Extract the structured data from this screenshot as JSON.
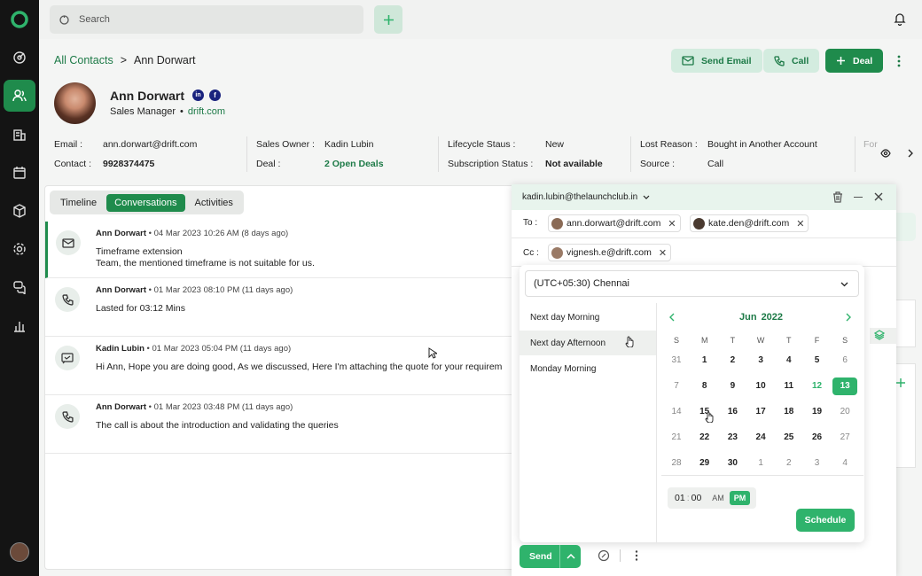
{
  "topbar": {
    "search_placeholder": "Search"
  },
  "breadcrumb": {
    "parent": "All Contacts",
    "sep": ">",
    "current": "Ann Dorwart"
  },
  "actions": {
    "send_email": "Send Email",
    "call": "Call",
    "deal": "Deal"
  },
  "contact": {
    "name": "Ann Dorwart",
    "title": "Sales Manager",
    "bullet": "•",
    "company": "drift.com",
    "linkedin": "in",
    "facebook": "f"
  },
  "fields": {
    "email_label": "Email :",
    "email": "ann.dorwart@drift.com",
    "contact_label": "Contact :",
    "contact": "9928374475",
    "owner_label": "Sales Owner :",
    "owner": "Kadin Lubin",
    "deal_label": "Deal :",
    "deal": "2 Open Deals",
    "lifecycle_label": "Lifecycle Staus :",
    "lifecycle": "New",
    "subscription_label": "Subscription Status :",
    "subscription": "Not available",
    "lost_label": "Lost Reason :",
    "lost": "Bought in Another Account",
    "source_label": "Source :",
    "source": "Call",
    "partial_label": "For"
  },
  "tabs": [
    "Timeline",
    "Conversations",
    "Activities"
  ],
  "conversations": [
    {
      "author": "Ann Dorwart",
      "dot": "•",
      "time": "04 Mar 2023 10:26 AM (8 days ago)",
      "line1": "Timeframe extension",
      "line2": "Team, the mentioned timeframe is not suitable for us."
    },
    {
      "author": "Ann Dorwart",
      "dot": "•",
      "time": "01 Mar 2023 08:10 PM (11 days ago)",
      "line1": "Lasted for 03:12 Mins"
    },
    {
      "author": "Kadin Lubin",
      "dot": "•",
      "time": "01 Mar 2023 05:04 PM (11 days ago)",
      "line1": "Hi Ann, Hope you are doing good, As we discussed, Here I'm attaching the quote for your requirem"
    },
    {
      "author": "Ann Dorwart",
      "dot": "•",
      "time": "01 Mar 2023 03:48 PM (11 days ago)",
      "line1": "The call is about the introduction and validating the queries"
    }
  ],
  "composer": {
    "from": "kadin.lubin@thelaunchclub.in",
    "to_label": "To :",
    "to": [
      "ann.dorwart@drift.com",
      "kate.den@drift.com"
    ],
    "cc_label": "Cc :",
    "cc": [
      "vignesh.e@drift.com"
    ],
    "send": "Send"
  },
  "schedule": {
    "timezone": "(UTC+05:30) Chennai",
    "options": [
      "Next day Morning",
      "Next day Afternoon",
      "Monday Morning"
    ],
    "month": "Jun",
    "year": "2022",
    "weekdays": [
      "S",
      "M",
      "T",
      "W",
      "T",
      "F",
      "S"
    ],
    "weeks": [
      [
        "31",
        "1",
        "2",
        "3",
        "4",
        "5",
        "6"
      ],
      [
        "7",
        "8",
        "9",
        "10",
        "11",
        "12",
        "13"
      ],
      [
        "14",
        "15",
        "16",
        "17",
        "18",
        "19",
        "20"
      ],
      [
        "21",
        "22",
        "23",
        "24",
        "25",
        "26",
        "27"
      ],
      [
        "28",
        "29",
        "30",
        "1",
        "2",
        "3",
        "4"
      ]
    ],
    "selected_day": "13",
    "today_day": "12",
    "hour": "01",
    "colon": ":",
    "minute": "00",
    "am": "AM",
    "pm": "PM",
    "button": "Schedule"
  },
  "colors": {
    "brand": "#1f8b4c",
    "accent": "#2fb36c"
  }
}
